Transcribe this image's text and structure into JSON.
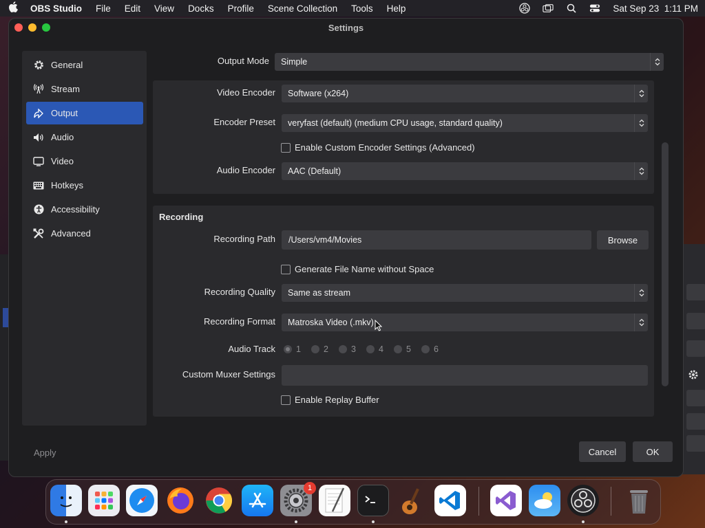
{
  "menubar": {
    "app_name": "OBS Studio",
    "items": [
      "File",
      "Edit",
      "View",
      "Docks",
      "Profile",
      "Scene Collection",
      "Tools",
      "Help"
    ],
    "datetime": "Sat Sep 23  1:11 PM"
  },
  "window": {
    "title": "Settings"
  },
  "sidebar": {
    "items": [
      {
        "label": "General",
        "icon": "gear-icon"
      },
      {
        "label": "Stream",
        "icon": "antenna-icon"
      },
      {
        "label": "Output",
        "icon": "output-icon"
      },
      {
        "label": "Audio",
        "icon": "speaker-icon"
      },
      {
        "label": "Video",
        "icon": "monitor-icon"
      },
      {
        "label": "Hotkeys",
        "icon": "keyboard-icon"
      },
      {
        "label": "Accessibility",
        "icon": "accessibility-icon"
      },
      {
        "label": "Advanced",
        "icon": "tools-icon"
      }
    ],
    "active": "Output"
  },
  "output": {
    "output_mode_label": "Output Mode",
    "output_mode_value": "Simple",
    "streaming": {
      "video_encoder_label": "Video Encoder",
      "video_encoder_value": "Software (x264)",
      "encoder_preset_label": "Encoder Preset",
      "encoder_preset_value": "veryfast (default) (medium CPU usage, standard quality)",
      "custom_encoder_label": "Enable Custom Encoder Settings (Advanced)",
      "audio_encoder_label": "Audio Encoder",
      "audio_encoder_value": "AAC (Default)"
    },
    "recording": {
      "title": "Recording",
      "path_label": "Recording Path",
      "path_value": "/Users/vm4/Movies",
      "browse_label": "Browse",
      "filename_nospace_label": "Generate File Name without Space",
      "quality_label": "Recording Quality",
      "quality_value": "Same as stream",
      "format_label": "Recording Format",
      "format_value": "Matroska Video (.mkv)",
      "audio_track_label": "Audio Track",
      "audio_tracks": [
        "1",
        "2",
        "3",
        "4",
        "5",
        "6"
      ],
      "muxer_label": "Custom Muxer Settings",
      "muxer_value": "",
      "replay_buffer_label": "Enable Replay Buffer"
    }
  },
  "footer": {
    "apply": "Apply",
    "cancel": "Cancel",
    "ok": "OK"
  },
  "dock": {
    "notification_badge": "1",
    "apps": [
      "Finder",
      "Launchpad",
      "Safari",
      "Firefox",
      "Chrome",
      "App Store",
      "System Settings",
      "TextEdit",
      "Terminal",
      "GarageBand",
      "VS Code",
      "Visual Studio",
      "Weather",
      "OBS Studio",
      "Trash"
    ]
  },
  "colors": {
    "accent": "#2b58b5",
    "window_bg": "#1e1e20",
    "panel_bg": "#2a2a2d",
    "control_bg": "#3b3b3f"
  }
}
